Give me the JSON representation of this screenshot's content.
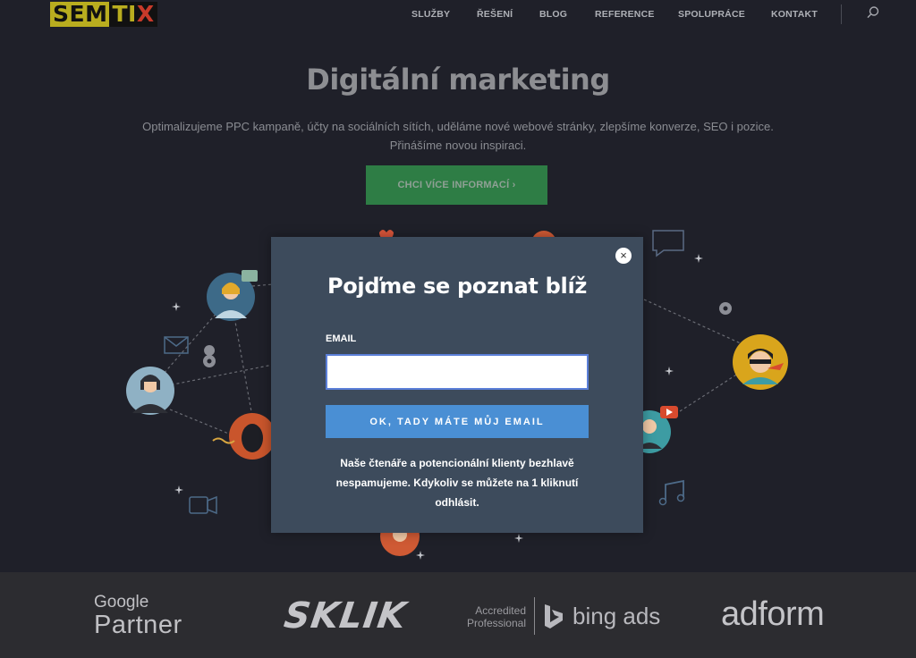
{
  "logo": {
    "sem": "SEM",
    "ti": "TI",
    "x": "X"
  },
  "nav": {
    "items": [
      "SLUŽBY",
      "ŘEŠENÍ",
      "BLOG",
      "REFERENCE",
      "SPOLUPRÁCE",
      "KONTAKT"
    ],
    "search_icon": "search-icon"
  },
  "hero": {
    "title": "Digitální marketing",
    "subtitle_line1": "Optimalizujeme PPC kampaně, účty na sociálních sítích, uděláme nové webové stránky, zlepšíme konverze, SEO i pozice.",
    "subtitle_line2": "Přinášíme novou inspiraci.",
    "cta": "CHCI VÍCE INFORMACÍ ›"
  },
  "modal": {
    "title": "Pojďme se poznat blíž",
    "email_label": "EMAIL",
    "email_value": "",
    "submit": "OK, TADY MÁTE MŮJ EMAIL",
    "note": "Naše čtenáře a potencionální klienty bezhlavě nespamujeme. Kdykoliv se můžete na 1 kliknutí odhlásit.",
    "close": "×"
  },
  "partners": {
    "google_line1": "Google",
    "google_line2": "Partner",
    "sklik": "SKLIK",
    "bing_accredited1": "Accredited",
    "bing_accredited2": "Professional",
    "bing_ads": "bing ads",
    "adform": "adform"
  },
  "colors": {
    "background": "#1f2029",
    "cta_green": "#2e7d45",
    "modal_bg": "#3d4b5c",
    "submit_blue": "#4a8fd4",
    "logo_yellow": "#b9ad1f"
  }
}
